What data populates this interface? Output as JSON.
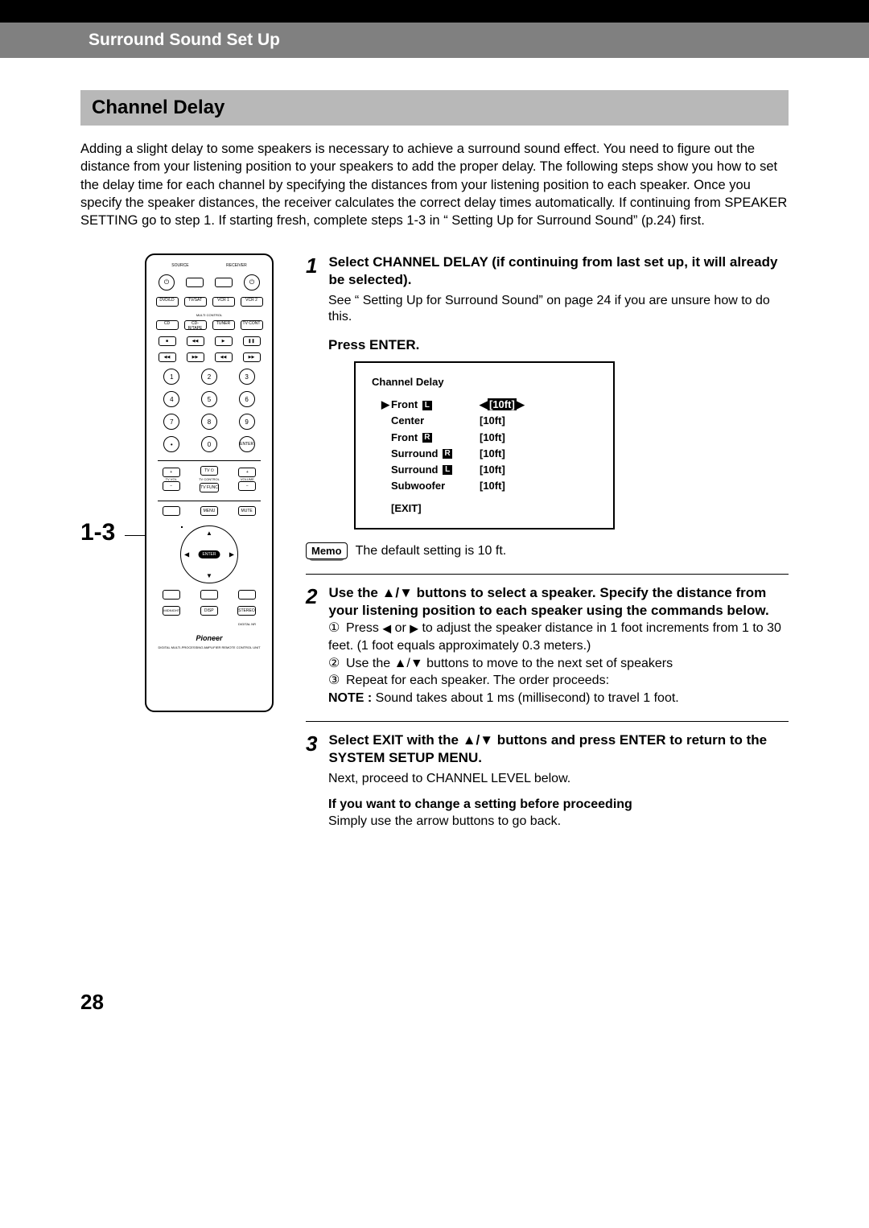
{
  "header": {
    "title": "Surround Sound Set Up"
  },
  "section": {
    "title": "Channel Delay",
    "intro": "Adding a slight delay to some speakers is necessary to achieve a surround sound effect. You need to figure out the distance from your listening position to your speakers to add the proper delay. The following steps show you how to set the delay time for each channel by specifying the distances from your listening position to each speaker. Once you specify the speaker distances, the receiver calculates the correct delay times automatically. If continuing from SPEAKER SETTING go to step 1. If starting fresh, complete steps 1-3 in “ Setting Up for Surround Sound” (p.24) first."
  },
  "callout": "1-3",
  "steps": {
    "s1": {
      "num": "1",
      "head": "Select CHANNEL DELAY (if continuing from last set up, it will already be selected).",
      "body": "See “ Setting Up for Surround Sound” on page 24 if you are unsure how to do this.",
      "press": "Press ENTER."
    },
    "s2": {
      "num": "2",
      "head": "Use the ▲/▼ buttons to select a speaker. Specify the distance from your listening position to each speaker using the commands below.",
      "sub1_pre": "Press ",
      "sub1_mid": " or ",
      "sub1_post": " to adjust the speaker distance in 1 foot increments from 1 to 30 feet. (1 foot equals approximately 0.3 meters.)",
      "sub2": "Use the ▲/▼ buttons to move to the next set of speakers",
      "sub3": "Repeat for each speaker. The order proceeds:",
      "note_label": "NOTE :",
      "note_text": " Sound takes about 1 ms (millisecond) to travel 1 foot."
    },
    "s3": {
      "num": "3",
      "head": "Select EXIT with the ▲/▼ buttons and press ENTER  to return to the SYSTEM SETUP MENU.",
      "body": "Next, proceed to CHANNEL LEVEL below.",
      "change_head": "If you want to change a setting before proceeding",
      "change_body": "Simply use the arrow buttons to go back."
    }
  },
  "osd": {
    "title": "Channel Delay",
    "rows": [
      {
        "ptr": "▶",
        "label": "Front",
        "tag": "L",
        "val": "[10ft]",
        "hl": true,
        "arrows": true
      },
      {
        "ptr": "",
        "label": "Center",
        "tag": "",
        "val": "[10ft]",
        "hl": false,
        "arrows": false
      },
      {
        "ptr": "",
        "label": "Front",
        "tag": "R",
        "val": "[10ft]",
        "hl": false,
        "arrows": false
      },
      {
        "ptr": "",
        "label": "Surround",
        "tag": "R",
        "val": "[10ft]",
        "hl": false,
        "arrows": false
      },
      {
        "ptr": "",
        "label": "Surround",
        "tag": "L",
        "val": "[10ft]",
        "hl": false,
        "arrows": false
      },
      {
        "ptr": "",
        "label": "Subwoofer",
        "tag": "",
        "val": "[10ft]",
        "hl": false,
        "arrows": false
      }
    ],
    "exit": "[EXIT]"
  },
  "memo": {
    "label": "Memo",
    "text": "The default setting is 10 ft."
  },
  "page_number": "28",
  "remote": {
    "brand": "Pioneer",
    "subtitle": "DIGITAL MULTI-PROCESSING AMPLIFIER REMOTE CONTROL UNIT",
    "top_left_label": "SOURCE",
    "top_right_label": "RECEIVER",
    "row_src": [
      "DVD/LD",
      "TV/SAT",
      "VCR 1",
      "VCR 2"
    ],
    "row_src2": [
      "CD",
      "CD-R/TAPE",
      "TUNER",
      "TV CONT"
    ],
    "multi_control": "MULTI CONTROL",
    "numpad": [
      "1",
      "2",
      "3",
      "4",
      "5",
      "6",
      "7",
      "8",
      "9",
      "0"
    ],
    "enter": "ENTER",
    "tv_vol": "TV VOL",
    "volume": "VOLUME",
    "tv_control": "TV CONTROL",
    "tv_func": "TV FUNC",
    "menu": "MENU",
    "mute": "MUTE",
    "midnight": "MIDNIGHT",
    "disp": "DISP",
    "stereo": "STEREO",
    "digital_nr": "DIGITAL NR"
  }
}
